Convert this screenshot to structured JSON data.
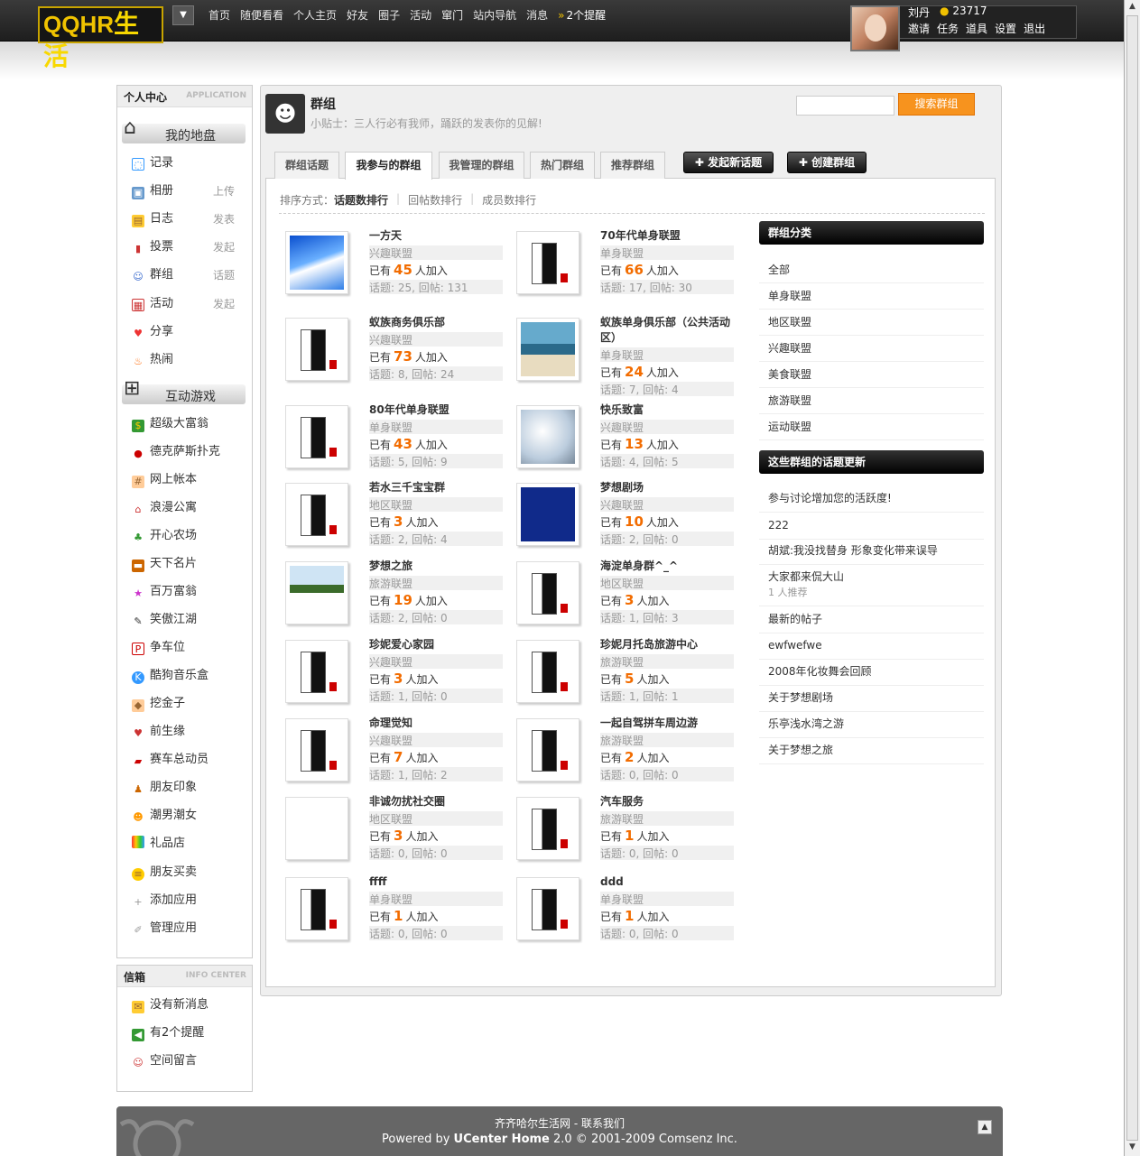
{
  "header": {
    "logo_latin": "QQHR",
    "logo_cn": "生活",
    "nav": [
      "首页",
      "随便看看",
      "个人主页",
      "好友",
      "圈子",
      "活动",
      "窜门",
      "站内导航",
      "消息"
    ],
    "notice": "2个提醒",
    "user_name": "刘丹",
    "credits": "23717",
    "user_links": [
      "邀请",
      "任务",
      "道具",
      "设置",
      "退出"
    ]
  },
  "sidebar": {
    "title": "个人中心",
    "subtitle": "APPLICATION",
    "section1": "我的地盘",
    "items": [
      {
        "label": "记录",
        "extra": ""
      },
      {
        "label": "相册",
        "extra": "上传"
      },
      {
        "label": "日志",
        "extra": "发表"
      },
      {
        "label": "投票",
        "extra": "发起"
      },
      {
        "label": "群组",
        "extra": "话题"
      },
      {
        "label": "活动",
        "extra": "发起"
      },
      {
        "label": "分享",
        "extra": ""
      },
      {
        "label": "热闹",
        "extra": ""
      }
    ],
    "section2": "互动游戏",
    "games": [
      "超级大富翁",
      "德克萨斯扑克",
      "网上帐本",
      "浪漫公寓",
      "开心农场",
      "天下名片",
      "百万富翁",
      "笑傲江湖",
      "争车位",
      "酷狗音乐盒",
      "挖金子",
      "前生缘",
      "赛车总动员",
      "朋友印象",
      "潮男潮女",
      "礼品店",
      "朋友买卖",
      "添加应用",
      "管理应用"
    ]
  },
  "inbox": {
    "title": "信箱",
    "subtitle": "INFO CENTER",
    "items": [
      "没有新消息",
      "有2个提醒",
      "空间留言"
    ]
  },
  "main": {
    "title": "群组",
    "tip": "小贴士：三人行必有我师，踊跃的发表你的见解!",
    "search_button": "搜索群组",
    "tabs": [
      "群组话题",
      "我参与的群组",
      "我管理的群组",
      "热门群组",
      "推荐群组"
    ],
    "new_topic": "发起新话题",
    "create_group": "创建群组",
    "sort_label": "排序方式：",
    "sort_options": [
      "话题数排行",
      "回帖数排行",
      "成员数排行"
    ],
    "member_prefix": "已有",
    "member_suffix": "人加入",
    "groups": [
      {
        "name": "一方天",
        "cat": "兴趣联盟",
        "members": "45",
        "stats": "话题: 25, 回帖: 131",
        "thumb": "sky"
      },
      {
        "name": "70年代单身联盟",
        "cat": "单身联盟",
        "members": "66",
        "stats": "话题: 17, 回帖: 30",
        "thumb": "box"
      },
      {
        "name": "蚁族商务俱乐部",
        "cat": "兴趣联盟",
        "members": "73",
        "stats": "话题: 8, 回帖: 24",
        "thumb": "box"
      },
      {
        "name": "蚁族单身俱乐部（公共活动区）",
        "cat": "单身联盟",
        "members": "24",
        "stats": "话题: 7, 回帖: 4",
        "thumb": "beach"
      },
      {
        "name": "80年代单身联盟",
        "cat": "单身联盟",
        "members": "43",
        "stats": "话题: 5, 回帖: 9",
        "thumb": "box"
      },
      {
        "name": "快乐致富",
        "cat": "兴趣联盟",
        "members": "13",
        "stats": "话题: 4, 回帖: 5",
        "thumb": "ice"
      },
      {
        "name": "若水三千宝宝群",
        "cat": "地区联盟",
        "members": "3",
        "stats": "话题: 2, 回帖: 4",
        "thumb": "box"
      },
      {
        "name": "梦想剧场",
        "cat": "兴趣联盟",
        "members": "10",
        "stats": "话题: 2, 回帖: 0",
        "thumb": "dream"
      },
      {
        "name": "梦想之旅",
        "cat": "旅游联盟",
        "members": "19",
        "stats": "话题: 2, 回帖: 0",
        "thumb": "palm"
      },
      {
        "name": "海淀单身群^_^",
        "cat": "地区联盟",
        "members": "3",
        "stats": "话题: 1, 回帖: 3",
        "thumb": "box"
      },
      {
        "name": "珍妮爱心家园",
        "cat": "兴趣联盟",
        "members": "3",
        "stats": "话题: 1, 回帖: 0",
        "thumb": "box"
      },
      {
        "name": "珍妮月托岛旅游中心",
        "cat": "旅游联盟",
        "members": "5",
        "stats": "话题: 1, 回帖: 1",
        "thumb": "box"
      },
      {
        "name": "命理觉知",
        "cat": "兴趣联盟",
        "members": "7",
        "stats": "话题: 1, 回帖: 2",
        "thumb": "box"
      },
      {
        "name": "一起自驾拼车周边游",
        "cat": "旅游联盟",
        "members": "2",
        "stats": "话题: 0, 回帖: 0",
        "thumb": "box"
      },
      {
        "name": "非诚勿扰社交圈",
        "cat": "地区联盟",
        "members": "3",
        "stats": "话题: 0, 回帖: 0",
        "thumb": "blank"
      },
      {
        "name": "汽车服务",
        "cat": "旅游联盟",
        "members": "1",
        "stats": "话题: 0, 回帖: 0",
        "thumb": "box"
      },
      {
        "name": "ffff",
        "cat": "单身联盟",
        "members": "1",
        "stats": "话题: 0, 回帖: 0",
        "thumb": "box"
      },
      {
        "name": "ddd",
        "cat": "单身联盟",
        "members": "1",
        "stats": "话题: 0, 回帖: 0",
        "thumb": "box"
      }
    ],
    "categories_title": "群组分类",
    "categories": [
      "全部",
      "单身联盟",
      "地区联盟",
      "兴趣联盟",
      "美食联盟",
      "旅游联盟",
      "运动联盟"
    ],
    "updates_title": "这些群组的话题更新",
    "updates": [
      {
        "title": "参与讨论增加您的活跃度!",
        "sub": ""
      },
      {
        "title": "222",
        "sub": ""
      },
      {
        "title": "胡斌:我没找替身 形象变化带来误导",
        "sub": ""
      },
      {
        "title": "大家都来侃大山",
        "sub": "1 人推荐"
      },
      {
        "title": "最新的帖子",
        "sub": ""
      },
      {
        "title": "ewfwefwe",
        "sub": ""
      },
      {
        "title": "2008年化妆舞会回顾",
        "sub": ""
      },
      {
        "title": "关于梦想剧场",
        "sub": ""
      },
      {
        "title": "乐亭浅水湾之游",
        "sub": ""
      },
      {
        "title": "关于梦想之旅",
        "sub": ""
      }
    ]
  },
  "footer": {
    "links": "齐齐哈尔生活网 - 联系我们",
    "powered_prefix": "Powered by",
    "powered_brand": "UCenter Home",
    "powered_suffix": "2.0 © 2001-2009 Comsenz Inc."
  }
}
